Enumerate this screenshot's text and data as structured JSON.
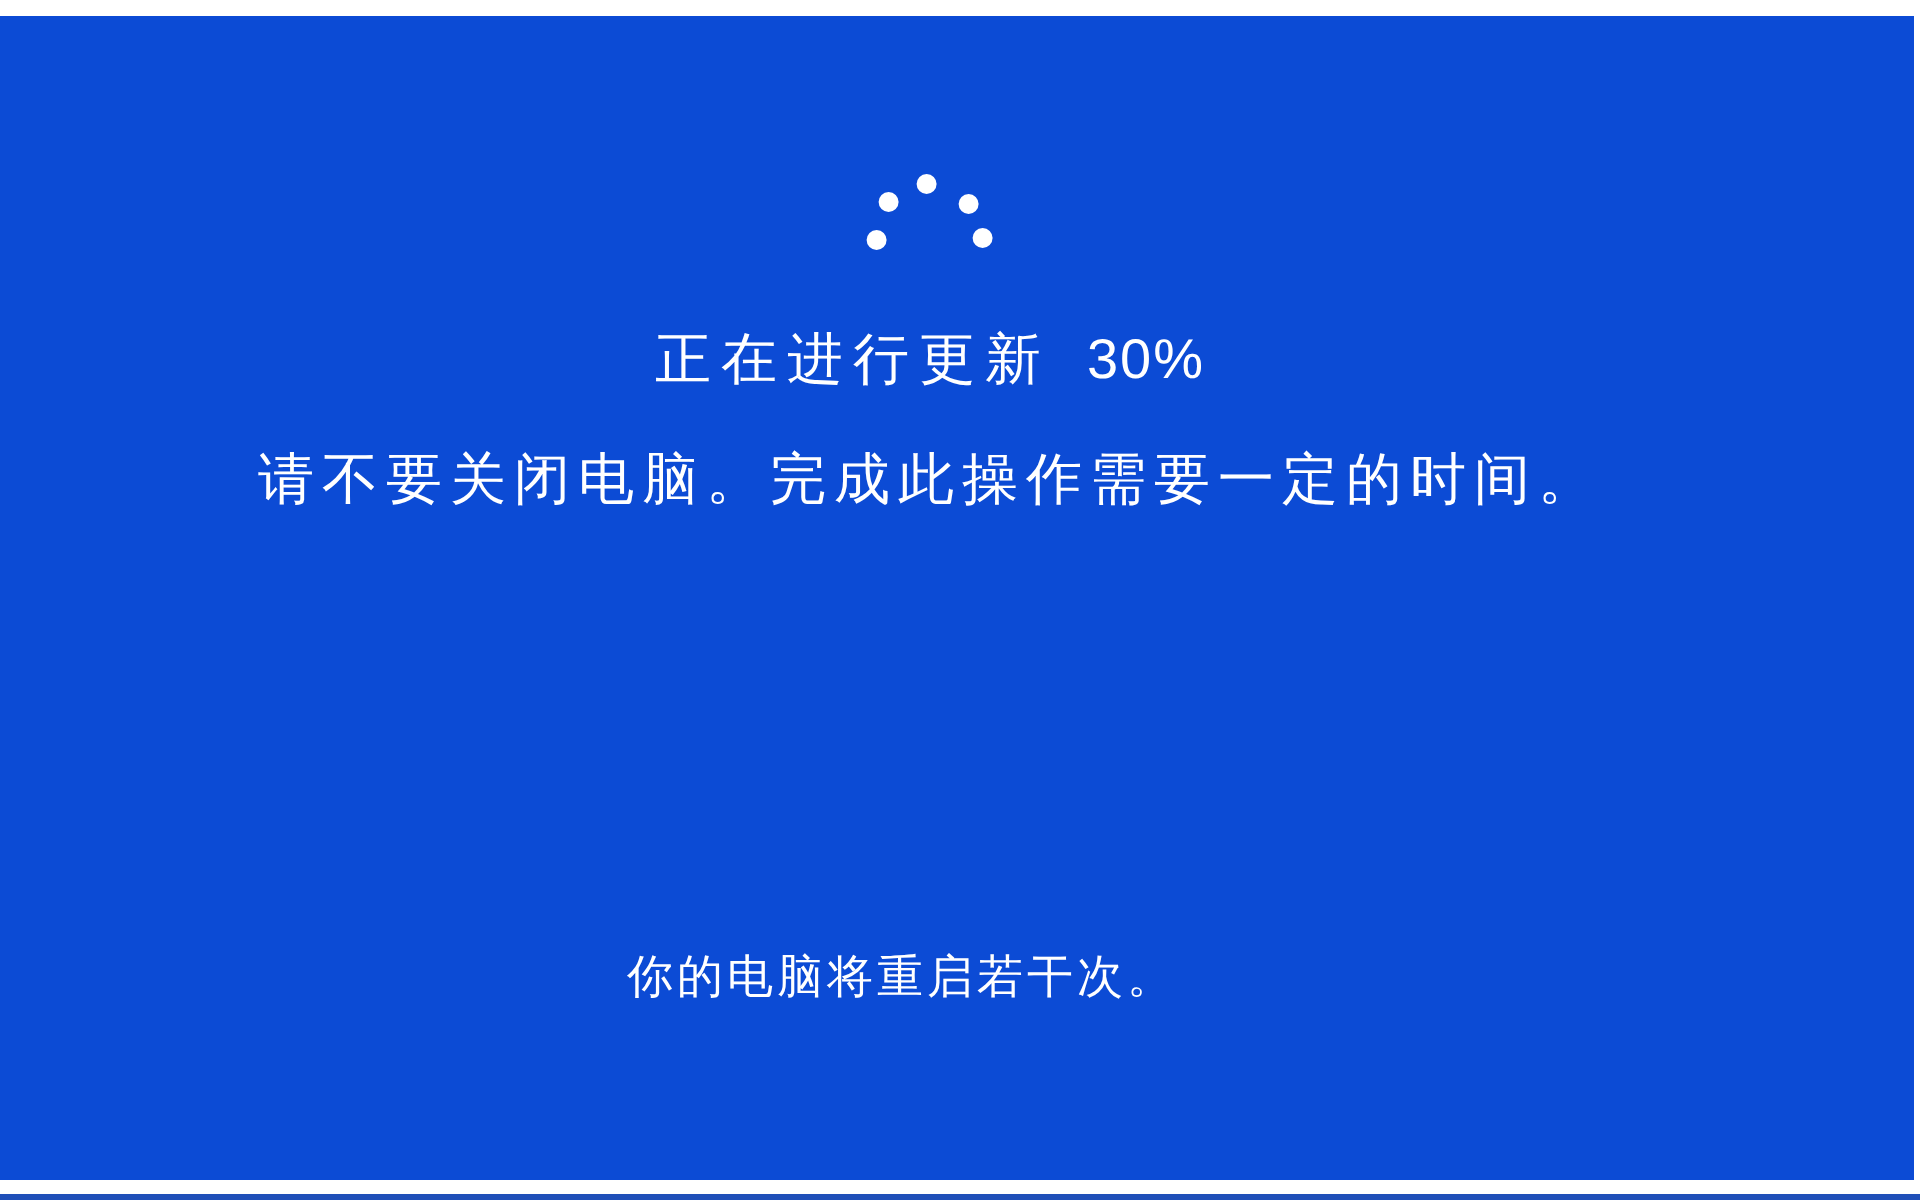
{
  "update": {
    "title": "正在进行更新",
    "progress": "30%",
    "message": "请不要关闭电脑。完成此操作需要一定的时间。",
    "note": "你的电脑将重启若干次。"
  }
}
